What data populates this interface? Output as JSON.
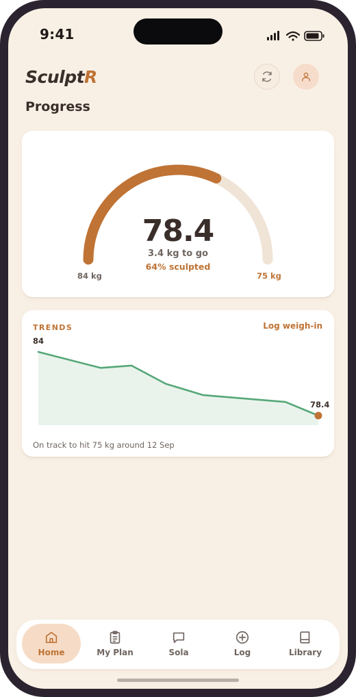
{
  "status": {
    "time": "9:41"
  },
  "header": {
    "brand_main": "Sculpt",
    "brand_accent": "R",
    "page_title": "Progress"
  },
  "icons": {
    "sync": "sync-icon",
    "profile": "user-icon"
  },
  "gauge": {
    "current": "78.4",
    "remaining": "3.4 kg to go",
    "percent_label": "64% sculpted",
    "start_label": "84 kg",
    "goal_label": "75 kg",
    "progress": 0.64,
    "colors": {
      "progress": "#bf7335",
      "track": "#f0e4d7"
    }
  },
  "trends": {
    "section_label": "TRENDS",
    "log_link": "Log weigh-in",
    "start_value_label": "84",
    "end_value_label": "78.4",
    "footnote": "On track to hit 75 kg around 12 Sep",
    "series": [
      84,
      82.6,
      82.8,
      81.2,
      80.2,
      79.6,
      78.4
    ],
    "colors": {
      "line": "#55a777",
      "fill": "#e9f3ec",
      "end_dot": "#bf7335"
    }
  },
  "tabs": [
    {
      "label": "Home",
      "icon": "home-icon",
      "active": true
    },
    {
      "label": "My Plan",
      "icon": "clipboard-icon",
      "active": false
    },
    {
      "label": "Sola",
      "icon": "chat-bubble-icon",
      "active": false
    },
    {
      "label": "Log",
      "icon": "plus-circle-icon",
      "active": false
    },
    {
      "label": "Library",
      "icon": "book-icon",
      "active": false
    }
  ]
}
